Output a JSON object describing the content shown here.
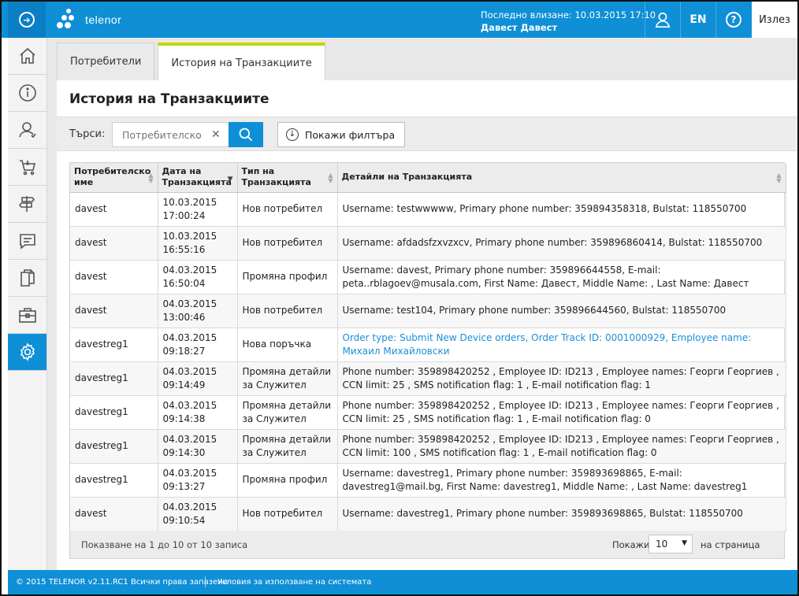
{
  "header": {
    "brand": "telenor",
    "last_login_label": "Последно влизане: 10.03.2015 17:10",
    "user_name": "Давест Давест",
    "lang": "EN",
    "help": "?",
    "logout": "Излез"
  },
  "sidebar": {
    "items": [
      {
        "name": "home-icon"
      },
      {
        "name": "info-icon"
      },
      {
        "name": "user-icon"
      },
      {
        "name": "cart-icon"
      },
      {
        "name": "signpost-icon"
      },
      {
        "name": "chat-icon"
      },
      {
        "name": "documents-icon"
      },
      {
        "name": "briefcase-icon"
      },
      {
        "name": "gear-icon"
      }
    ],
    "active_index": 8
  },
  "tabs": [
    {
      "label": "Потребители",
      "active": false
    },
    {
      "label": "История на Транзакциите",
      "active": true
    }
  ],
  "page": {
    "title": "История на Транзакциите",
    "search_label": "Търси:",
    "search_placeholder": "Потребителско",
    "filter_label": "Покажи филтъра"
  },
  "table": {
    "columns": [
      "Потребителско име",
      "Дата на Транзакцията",
      "Тип на Транзакцията",
      "Детайли на Транзакцията"
    ],
    "sorted_column": 1,
    "rows": [
      {
        "user": "davest",
        "date": "10.03.2015",
        "time": "17:00:24",
        "type": "Нов потребител",
        "details": "Username: testwwwww, Primary phone number: 359894358318, Bulstat: 118550700",
        "link": false
      },
      {
        "user": "davest",
        "date": "10.03.2015",
        "time": "16:55:16",
        "type": "Нов потребител",
        "details": "Username: afdadsfzxvzxcv, Primary phone number: 359896860414, Bulstat: 118550700",
        "link": false
      },
      {
        "user": "davest",
        "date": "04.03.2015",
        "time": "16:50:04",
        "type": "Промяна профил",
        "details": "Username: davest, Primary phone number: 359896644558, E-mail: peta..rblagoev@musala.com, First Name: Давест, Middle Name: , Last Name: Давест",
        "link": false
      },
      {
        "user": "davest",
        "date": "04.03.2015",
        "time": "13:00:46",
        "type": "Нов потребител",
        "details": "Username: test104, Primary phone number: 359896644560, Bulstat: 118550700",
        "link": false
      },
      {
        "user": "davestreg1",
        "date": "04.03.2015",
        "time": "09:18:27",
        "type": "Нова поръчка",
        "details": "Order type: Submit New Device orders, Order Track ID: 0001000929, Employee name: Михаил Михайловски",
        "link": true
      },
      {
        "user": "davestreg1",
        "date": "04.03.2015",
        "time": "09:14:49",
        "type": "Промяна детайли за Служител",
        "details": "Phone number: 359898420252 , Employee ID: ID213 , Employee names: Георги Георгиев , CCN limit: 25 , SMS notification flag: 1 , E-mail notification flag: 1",
        "link": false
      },
      {
        "user": "davestreg1",
        "date": "04.03.2015",
        "time": "09:14:38",
        "type": "Промяна детайли за Служител",
        "details": "Phone number: 359898420252 , Employee ID: ID213 , Employee names: Георги Георгиев , CCN limit: 25 , SMS notification flag: 1 , E-mail notification flag: 0",
        "link": false
      },
      {
        "user": "davestreg1",
        "date": "04.03.2015",
        "time": "09:14:30",
        "type": "Промяна детайли за Служител",
        "details": "Phone number: 359898420252 , Employee ID: ID213 , Employee names: Георги Георгиев , CCN limit: 100 , SMS notification flag: 1 , E-mail notification flag: 0",
        "link": false
      },
      {
        "user": "davestreg1",
        "date": "04.03.2015",
        "time": "09:13:27",
        "type": "Промяна профил",
        "details": "Username: davestreg1, Primary phone number: 359893698865, E-mail: davestreg1@mail.bg, First Name: davestreg1, Middle Name: , Last Name: davestreg1",
        "link": false
      },
      {
        "user": "davest",
        "date": "04.03.2015",
        "time": "09:10:54",
        "type": "Нов потребител",
        "details": "Username: davestreg1, Primary phone number: 359893698865, Bulstat: 118550700",
        "link": false
      }
    ]
  },
  "pagination": {
    "info": "Показване на 1 до 10 от 10 записа",
    "show_label": "Покажи",
    "page_size": "10",
    "per_page_label": "на страница"
  },
  "footer": {
    "copyright": "© 2015 TELENOR v2.11.RC1 Всички права запазени",
    "terms": "Условия за използване на системата"
  },
  "colors": {
    "accent": "#0f8fd6",
    "tab_highlight": "#c5d600",
    "link": "#1b8fd6"
  }
}
